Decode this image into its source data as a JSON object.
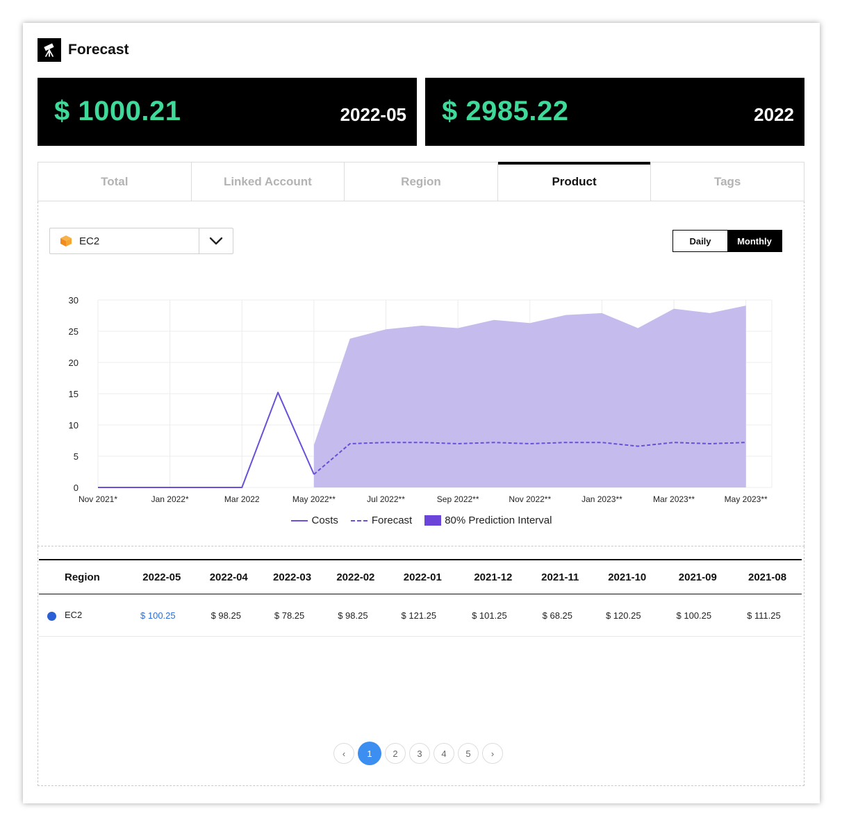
{
  "header": {
    "title": "Forecast",
    "icon": "telescope-icon"
  },
  "kpis": [
    {
      "amount": "$ 1000.21",
      "period": "2022-05"
    },
    {
      "amount": "$ 2985.22",
      "period": "2022"
    }
  ],
  "tabs": [
    {
      "label": "Total",
      "active": false
    },
    {
      "label": "Linked Account",
      "active": false
    },
    {
      "label": "Region",
      "active": false
    },
    {
      "label": "Product",
      "active": true
    },
    {
      "label": "Tags",
      "active": false
    }
  ],
  "dropdown": {
    "selected": "EC2",
    "icon": "ec2-box-icon"
  },
  "granularity": {
    "options": [
      "Daily",
      "Monthly"
    ],
    "selected": "Monthly"
  },
  "chart_data": {
    "type": "line",
    "categories": [
      "Nov 2021*",
      "Dec 2021*",
      "Jan 2022*",
      "Feb 2022*",
      "Mar 2022",
      "Apr 2022",
      "May 2022**",
      "Jun 2022**",
      "Jul 2022**",
      "Aug 2022**",
      "Sep 2022**",
      "Oct 2022**",
      "Nov 2022**",
      "Dec 2022**",
      "Jan 2023**",
      "Feb 2023**",
      "Mar 2023**",
      "Apr 2023**",
      "May 2023**"
    ],
    "tick_labels": [
      "Nov 2021*",
      "Jan 2022*",
      "Mar 2022",
      "May 2022**",
      "Jul 2022**",
      "Sep 2022**",
      "Nov 2022**",
      "Jan 2023**",
      "Mar 2023**",
      "May 2023**"
    ],
    "yticks": [
      0,
      5,
      10,
      15,
      20,
      25,
      30
    ],
    "ylim": [
      0,
      30
    ],
    "series": [
      {
        "name": "Costs",
        "style": "solid",
        "start": 0,
        "values": [
          0,
          0,
          0,
          0,
          0,
          15.2,
          2.1
        ]
      },
      {
        "name": "Forecast",
        "style": "dashed",
        "start": 6,
        "values": [
          2.1,
          7.0,
          7.2,
          7.2,
          7.0,
          7.2,
          7.0,
          7.2,
          7.2,
          6.6,
          7.2,
          7.0,
          7.2
        ]
      }
    ],
    "interval": {
      "name": "80% Prediction Interval",
      "start": 6,
      "upper": [
        6.8,
        23.8,
        25.3,
        25.9,
        25.5,
        26.8,
        26.3,
        27.6,
        27.9,
        25.5,
        28.6,
        27.9,
        29.1
      ],
      "lower": [
        0,
        0,
        0,
        0,
        0,
        0,
        0,
        0,
        0,
        0,
        0,
        0,
        0
      ]
    },
    "grid": true,
    "legend": "bottom-center",
    "colors": {
      "line": "#6a4fd8",
      "interval": "#c5bced",
      "legend_box": "#6b44d9"
    }
  },
  "table": {
    "headers": [
      "Region",
      "2022-05",
      "2022-04",
      "2022-03",
      "2022-02",
      "2022-01",
      "2021-12",
      "2021-11",
      "2021-10",
      "2021-09",
      "2021-08"
    ],
    "rows": [
      {
        "name": "EC2",
        "cells": [
          "$ 100.25",
          "$ 98.25",
          "$ 78.25",
          "$ 98.25",
          "$ 121.25",
          "$ 101.25",
          "$ 68.25",
          "$ 120.25",
          "$ 100.25",
          "$ 111.25"
        ]
      }
    ]
  },
  "pagination": {
    "prev": "‹",
    "pages": [
      "1",
      "2",
      "3",
      "4",
      "5"
    ],
    "next": "›",
    "current": "1"
  }
}
